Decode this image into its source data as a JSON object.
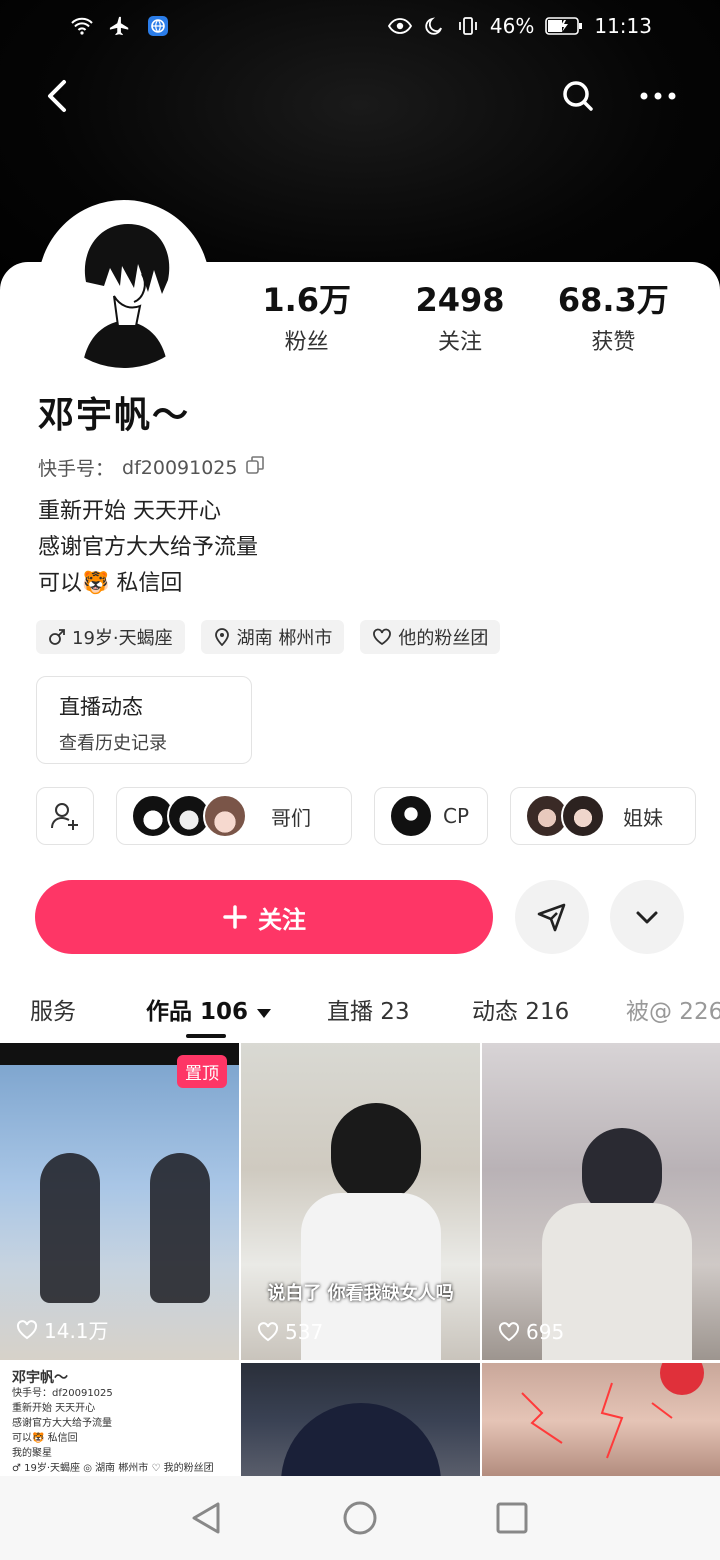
{
  "status": {
    "battery": "46%",
    "time": "11:13"
  },
  "profile": {
    "name": "邓宇帆～",
    "kuaishou_id_label": "快手号：",
    "kuaishou_id": "df20091025",
    "bio_lines": [
      "重新开始 天天开心",
      "感谢官方大大给予流量",
      "可以🐯 私信回"
    ],
    "stats": [
      {
        "num": "1.6万",
        "label": "粉丝"
      },
      {
        "num": "2498",
        "label": "关注"
      },
      {
        "num": "68.3万",
        "label": "获赞"
      }
    ],
    "tags": [
      {
        "icon": "male-icon",
        "text": "19岁·天蝎座"
      },
      {
        "icon": "location-icon",
        "text": "湖南 郴州市"
      },
      {
        "icon": "heart-outline-icon",
        "text": "他的粉丝团"
      }
    ],
    "live": {
      "title": "直播动态",
      "sub": "查看历史记录"
    },
    "groups": [
      {
        "label": "哥们"
      },
      {
        "label": "CP"
      },
      {
        "label": "姐妹"
      }
    ],
    "follow_label": "关注"
  },
  "tabs": [
    {
      "label": "服务"
    },
    {
      "label": "作品 106"
    },
    {
      "label": "直播 23"
    },
    {
      "label": "动态 216"
    },
    {
      "label": "被@ 226"
    }
  ],
  "posts": [
    {
      "likes": "14.1万",
      "pinned": "置顶"
    },
    {
      "likes": "537",
      "caption": "说白了 你看我缺女人吗"
    },
    {
      "likes": "695"
    }
  ],
  "mini_profile": {
    "name": "邓宇帆～",
    "id": "快手号：df20091025",
    "lines": [
      "重新开始 天天开心",
      "感谢官方大大给予流量",
      "可以🐯 私信回",
      "我的聚星"
    ],
    "tags": "♂ 19岁·天蝎座   ◎ 湖南 郴州市   ♡ 我的粉丝团"
  },
  "colors": {
    "accent": "#fe3666",
    "dark": "#000000"
  }
}
